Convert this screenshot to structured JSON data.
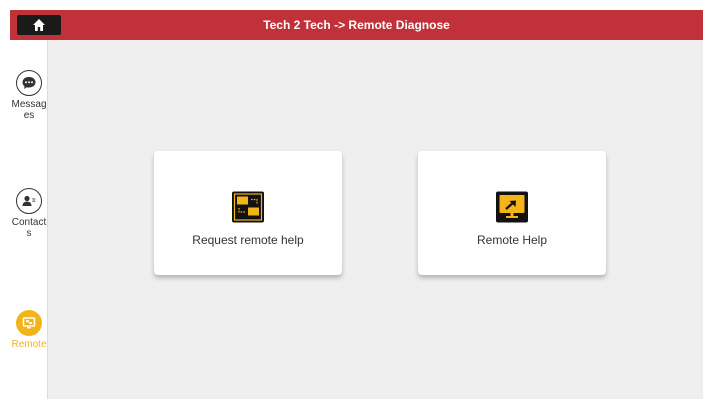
{
  "header": {
    "title": "Tech 2 Tech -> Remote Diagnose",
    "home_icon": "home-icon"
  },
  "sidebar": {
    "items": [
      {
        "label": "Messages",
        "icon": "chat-bubble-icon",
        "active": false
      },
      {
        "label": "Contacts",
        "icon": "contact-card-icon",
        "active": false
      },
      {
        "label": "Remote",
        "icon": "remote-screen-icon",
        "active": true
      }
    ]
  },
  "main": {
    "cards": [
      {
        "label": "Request remote help",
        "icon": "request-remote-icon"
      },
      {
        "label": "Remote Help",
        "icon": "remote-monitor-icon"
      }
    ]
  },
  "colors": {
    "header_bg": "#c0313a",
    "accent": "#f2b418",
    "content_bg": "#efefef"
  }
}
